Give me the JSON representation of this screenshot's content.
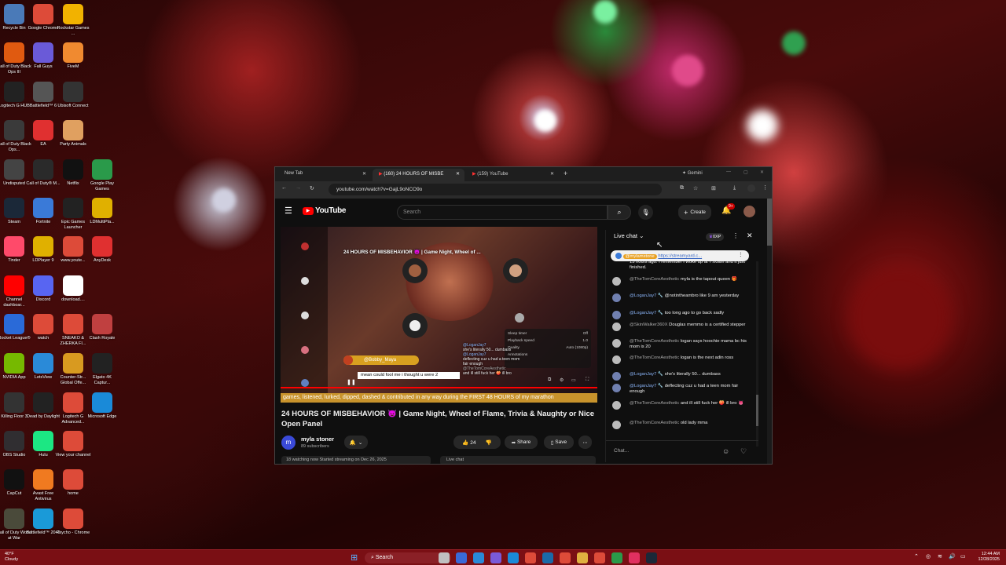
{
  "desktop": {
    "icons": [
      {
        "label": "Recycle Bin",
        "color": "#4a7ab8"
      },
      {
        "label": "Google Chrome",
        "color": "#dd4b39"
      },
      {
        "label": "Rockstar Games ...",
        "color": "#f2b200"
      },
      {
        "label": "Call of Duty Black Ops III",
        "color": "#e05a10"
      },
      {
        "label": "Fall Guys",
        "color": "#6a5ad8"
      },
      {
        "label": "FiveM",
        "color": "#f08a30"
      },
      {
        "label": "Logitech G HUB",
        "color": "#222222"
      },
      {
        "label": "Battlefield™ 6",
        "color": "#555555"
      },
      {
        "label": "Ubisoft Connect",
        "color": "#333333"
      },
      {
        "label": "Call of Duty Black Ops...",
        "color": "#3a3a3a"
      },
      {
        "label": "EA",
        "color": "#e03030"
      },
      {
        "label": "Party Animals",
        "color": "#e0a060"
      },
      {
        "label": "Undisputed",
        "color": "#444444"
      },
      {
        "label": "Call of Duty® M...",
        "color": "#2a2a2a"
      },
      {
        "label": "Netflix",
        "color": "#111111"
      },
      {
        "label": "Google Play Games",
        "color": "#2a9a4a"
      },
      {
        "label": "Steam",
        "color": "#1b2838"
      },
      {
        "label": "Fortnite",
        "color": "#3a7ad8"
      },
      {
        "label": "Epic Games Launcher",
        "color": "#222222"
      },
      {
        "label": "LDMultiPla...",
        "color": "#e0b000"
      },
      {
        "label": "Tinder",
        "color": "#ff4a6a"
      },
      {
        "label": "LDPlayer 9",
        "color": "#e0b000"
      },
      {
        "label": "www.youte...",
        "color": "#dd4b39"
      },
      {
        "label": "AnyDesk",
        "color": "#e03030"
      },
      {
        "label": "Channel dashboar...",
        "color": "#ff0000"
      },
      {
        "label": "Discord",
        "color": "#5865f2"
      },
      {
        "label": "download....",
        "color": "#ffffff"
      },
      {
        "label": "Rocket League®",
        "color": "#2a6ad8"
      },
      {
        "label": "watch",
        "color": "#dd4b39"
      },
      {
        "label": "SNEAKO & ZHERKA FI...",
        "color": "#dd4b39"
      },
      {
        "label": "Clash Royale",
        "color": "#c04040"
      },
      {
        "label": "NVIDIA App",
        "color": "#76b900"
      },
      {
        "label": "LetsView",
        "color": "#2a8ad8"
      },
      {
        "label": "Counter-Str... Global Offe...",
        "color": "#d89a20"
      },
      {
        "label": "Elgato 4K Captur...",
        "color": "#222222"
      },
      {
        "label": "Killing Floor 3",
        "color": "#333333"
      },
      {
        "label": "Dead by Daylight",
        "color": "#222222"
      },
      {
        "label": "Logitech G Advanced...",
        "color": "#dd4b39"
      },
      {
        "label": "Microsoft Edge",
        "color": "#1a8ad8"
      },
      {
        "label": "OBS Studio",
        "color": "#302e31"
      },
      {
        "label": "Hulu",
        "color": "#1ce783"
      },
      {
        "label": "View your channel",
        "color": "#dd4b39"
      },
      {
        "label": "CapCut",
        "color": "#111111"
      },
      {
        "label": "Avast Free Antivirus",
        "color": "#f07a20"
      },
      {
        "label": "home",
        "color": "#dd4b39"
      },
      {
        "label": "Call of Duty World at War",
        "color": "#4a4a3a"
      },
      {
        "label": "Battlefield™ 2042",
        "color": "#1a9ad8"
      },
      {
        "label": "Psycho - Chrome",
        "color": "#dd4b39"
      }
    ]
  },
  "browser": {
    "tabs": [
      {
        "label": "New Tab"
      },
      {
        "label": "(160) 24 HOURS OF MISBE"
      },
      {
        "label": "(159) YouTube"
      }
    ],
    "gemini_label": "Gemini",
    "url": "youtube.com/watch?v=GajL9oNCO9o"
  },
  "youtube": {
    "logo_text": "YouTube",
    "search_placeholder": "Search",
    "create_label": "Create",
    "notif_count": "9+",
    "player": {
      "overlay_title": "24 HOURS OF MISBEHAVIOR 😈 | Game Night, Wheel of ...",
      "name_tag": "@Bobby_Maya",
      "caption": "mean could fool me i thought u were 2",
      "menu_items": [
        "Sleep timer",
        "Playback speed",
        "Quality",
        "Annotations"
      ],
      "menu_values": [
        "Off",
        "1.0",
        "Auto (1080p)"
      ],
      "mini_chat": [
        "@LoganJay7",
        "she's literally 50... dumbass",
        "@LoganJay7",
        "deflecting cuz u had a teen mom fair enough",
        "@TheTomCoreAesthetic",
        "and ill still fuck her 🍑 ill bro"
      ]
    },
    "banner_text": "games, listened, lurked, dipped, dashed & contributed in any way during the FIRST 48 HOURS of my marathon",
    "video_title": "24 HOURS OF MISBEHAVIOR 👿 | Game Night, Wheel of Flame, Trivia & Naughty or Nice Open Panel",
    "channel_name": "myla stoner",
    "subscribers": "89 subscribers",
    "likes": "24",
    "share_label": "Share",
    "save_label": "Save",
    "watching_text": "18 watching now  Started streaming on Dec 26, 2025",
    "below_chat_label": "Live chat"
  },
  "chat": {
    "header": "Live chat",
    "xp_label": "0XP",
    "pinned_author": "@mylamstone",
    "pinned_link": "https://streamyard.c...",
    "messages": [
      {
        "author": "",
        "text": "15 hours ago. I remember I woke up at 7:00am and it just finished.",
        "color": "#8ab4f8"
      },
      {
        "author": "@TheTomCoreAesthetic",
        "text": "myla is the tapout queen 🎁",
        "color": "#aaaaaa"
      },
      {
        "author": "@LoganJay7 🔧",
        "text": "@notintheambro like 9 am yesterday",
        "color": "#8ab4f8"
      },
      {
        "author": "@LoganJay7 🔧",
        "text": "too long ago to go back sadly",
        "color": "#8ab4f8"
      },
      {
        "author": "@SkinWalker360X",
        "text": "Douglas memmo is a certified stepper",
        "color": "#aaaaaa"
      },
      {
        "author": "@TheTomCoreAesthetic",
        "text": "logan says hoochie mama bc his mom is 20",
        "color": "#aaaaaa"
      },
      {
        "author": "@TheTomCoreAesthetic",
        "text": "logan is the next adin ross",
        "color": "#aaaaaa"
      },
      {
        "author": "@LoganJay7 🔧",
        "text": "she's literally 50... dumbass",
        "color": "#8ab4f8"
      },
      {
        "author": "@LoganJay7 🔧",
        "text": "deflecting cuz u had a teen mom fair enough",
        "color": "#8ab4f8"
      },
      {
        "author": "@TheTomCoreAesthetic",
        "text": "and ill still fuck her 🍑 ill bro 👅",
        "color": "#aaaaaa"
      },
      {
        "author": "@TheTomCoreAesthetic",
        "text": "old lady mma",
        "color": "#aaaaaa"
      }
    ],
    "input_placeholder": "Chat..."
  },
  "taskbar": {
    "weather_temp": "40°F",
    "weather_desc": "Cloudy",
    "search_label": "Search",
    "time": "12:44 AM",
    "date": "12/28/2025"
  }
}
